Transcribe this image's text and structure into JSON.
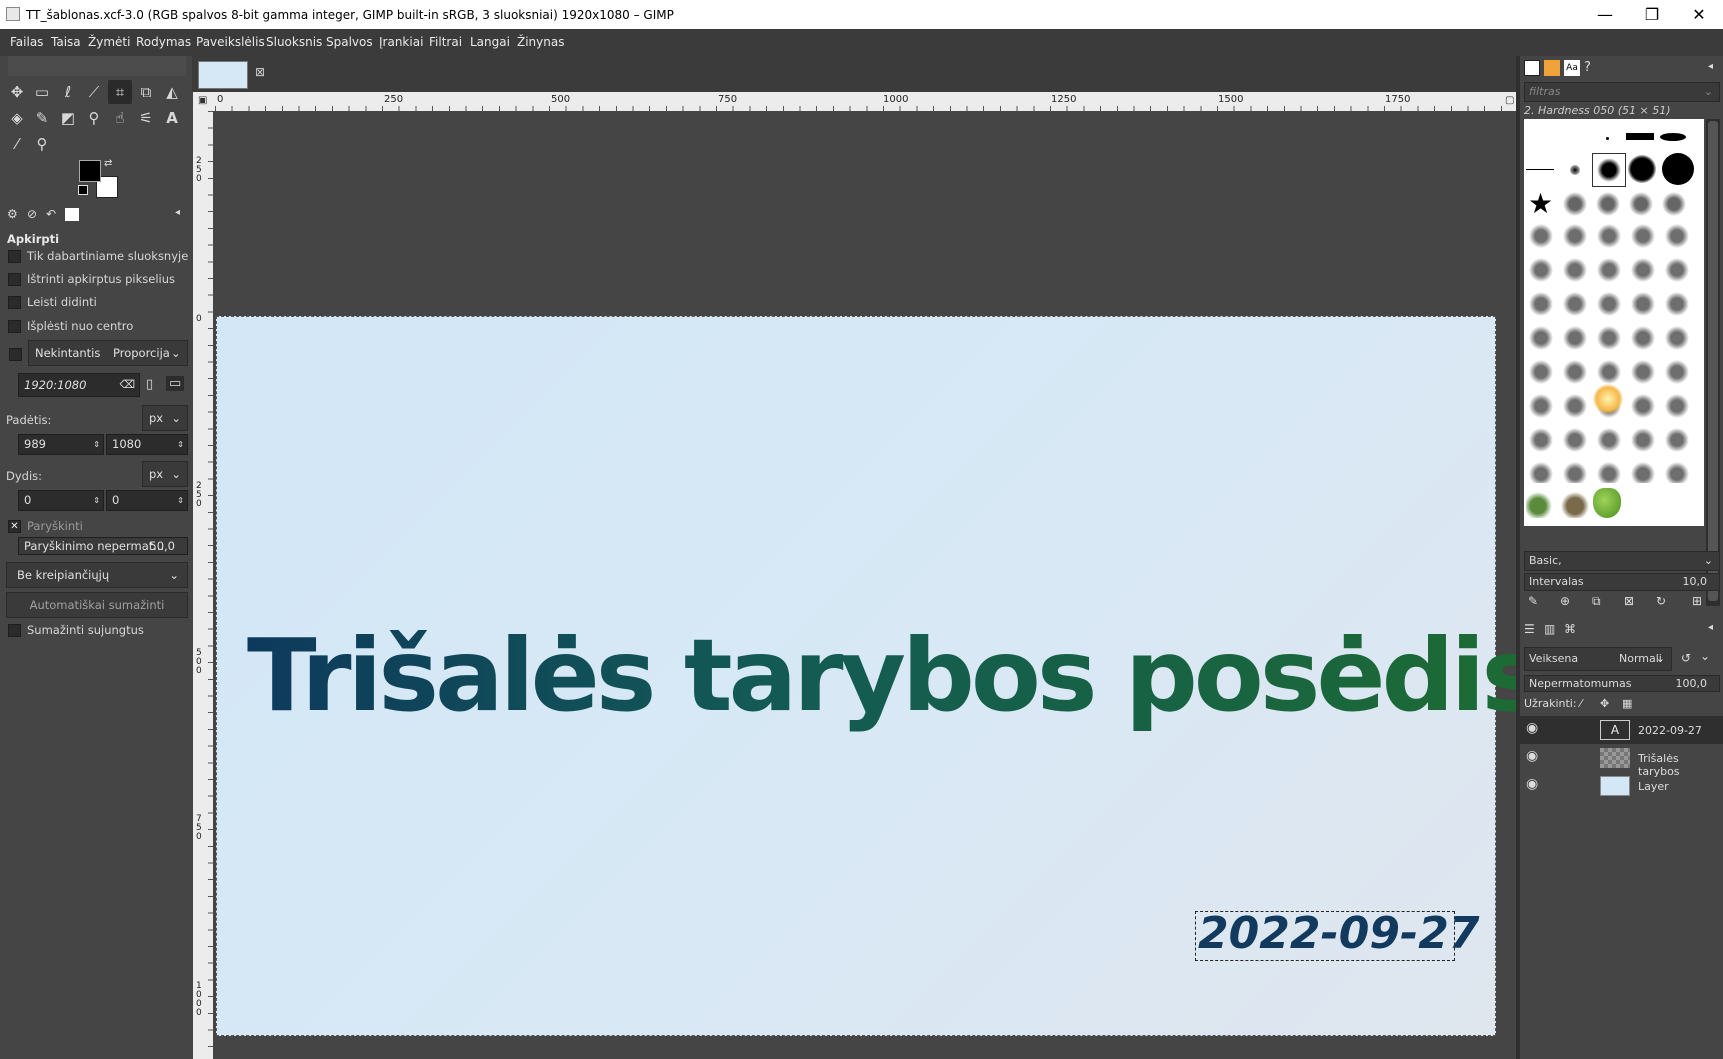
{
  "window": {
    "title": "TT_šablonas.xcf-3.0 (RGB spalvos 8-bit gamma integer, GIMP built-in sRGB, 3 sluoksniai) 1920x1080 – GIMP",
    "minimize": "—",
    "maximize": "❐",
    "close": "✕"
  },
  "menu": [
    "Failas",
    "Taisa",
    "Žymėti",
    "Rodymas",
    "Paveikslėlis",
    "Sluoksnis",
    "Spalvos",
    "Įrankiai",
    "Filtrai",
    "Langai",
    "Žinynas"
  ],
  "tool_options": {
    "heading": "Apkirpti",
    "opt_current_layer": "Tik dabartiniame sluoksnyje",
    "opt_delete_pixels": "Ištrinti apkirptus pikselius",
    "opt_allow_grow": "Leisti didinti",
    "opt_expand_center": "Išplėsti nuo centro",
    "fixed_label": "Nekintantis",
    "fixed_mode": "Proporcija",
    "aspect_value": "1920:1080",
    "position_label": "Padėtis:",
    "position_unit": "px",
    "pos_x": "989",
    "pos_y": "1080",
    "size_label": "Dydis:",
    "size_unit": "px",
    "size_w": "0",
    "size_h": "0",
    "highlight_label": "Paryškinti",
    "highlight_opacity_label": "Paryškinimo nepermat...",
    "highlight_opacity_value": "50,0",
    "guides": "Be kreipiančiųjų",
    "auto_shrink": "Automatiškai sumažinti",
    "shrink_merged": "Sumažinti sujungtus"
  },
  "rulers": {
    "h_ticks": [
      "0",
      "250",
      "500",
      "750",
      "1000",
      "1250",
      "1500",
      "1750"
    ],
    "v_ticks": [
      "2",
      "5",
      "0",
      "0",
      "2",
      "5",
      "0",
      "5",
      "0",
      "0",
      "7",
      "5",
      "0",
      "1",
      "0",
      "0",
      "0"
    ]
  },
  "canvas": {
    "title_text": "Trišalės tarybos posėdis",
    "date_text": "2022-09-27"
  },
  "brushes": {
    "filter_placeholder": "filtras",
    "selected_brush": "2. Hardness 050 (51 × 51)",
    "preset": "Basic,",
    "spacing_label": "Intervalas",
    "spacing_value": "10,0"
  },
  "layers": {
    "mode_label": "Veiksena",
    "mode_value": "Normali",
    "opacity_label": "Nepermatomumas",
    "opacity_value": "100,0",
    "lock_label": "Užrakinti:",
    "items": [
      {
        "name": "2022-09-27"
      },
      {
        "name": "Trišalės tarybos"
      },
      {
        "name": "Layer"
      }
    ]
  },
  "colors": {
    "menubar_bg": "#3b3b3b",
    "panel_bg": "#454545",
    "title_gradient_start": "#0d3a5c",
    "title_gradient_end": "#1d6b33",
    "date_color": "#123a5e"
  }
}
